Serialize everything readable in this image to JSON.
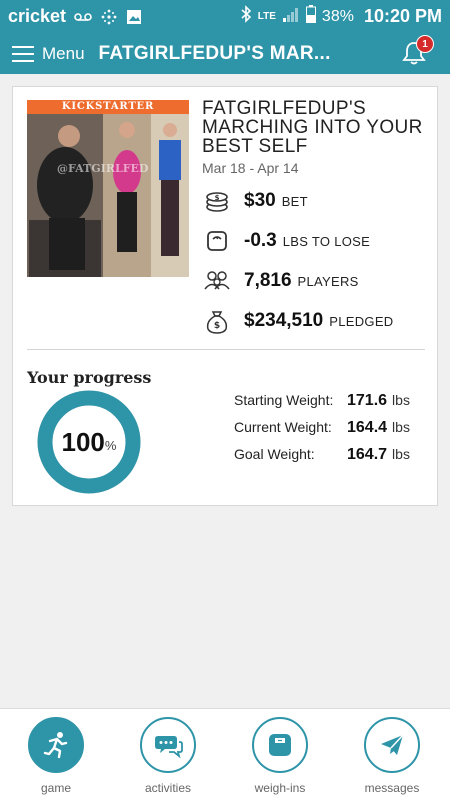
{
  "status_bar": {
    "carrier": "cricket",
    "network": "LTE",
    "battery": "38%",
    "time": "10:20 PM"
  },
  "app_bar": {
    "menu_label": "Menu",
    "title": "FATGIRLFEDUP'S MAR...",
    "notification_count": "1"
  },
  "challenge": {
    "image_banner": "KICKSTARTER",
    "image_watermark": "@FATGIRLFED",
    "title": "FATGIRLFEDUP'S MARCHING INTO YOUR BEST SELF",
    "dates": "Mar 18 - Apr 14",
    "stats": [
      {
        "icon": "coins-icon",
        "value": "$30",
        "unit": "BET"
      },
      {
        "icon": "scale-icon",
        "value": "-0.3",
        "unit": "LBS TO LOSE"
      },
      {
        "icon": "players-icon",
        "value": "7,816",
        "unit": "PLAYERS"
      },
      {
        "icon": "money-bag-icon",
        "value": "$234,510",
        "unit": "PLEDGED"
      }
    ]
  },
  "progress": {
    "heading": "Your progress",
    "percent_value": "100",
    "percent_sign": "%",
    "fraction": 1.0,
    "rows": [
      {
        "label": "Starting Weight:",
        "value": "171.6",
        "unit": "lbs"
      },
      {
        "label": "Current Weight:",
        "value": "164.4",
        "unit": "lbs"
      },
      {
        "label": "Goal Weight:",
        "value": "164.7",
        "unit": "lbs"
      }
    ]
  },
  "bottom_nav": [
    {
      "icon": "runner-icon",
      "label": "game",
      "active": true
    },
    {
      "icon": "chat-bubbles-icon",
      "label": "activities",
      "active": false
    },
    {
      "icon": "scale-icon",
      "label": "weigh-ins",
      "active": false
    },
    {
      "icon": "paper-plane-icon",
      "label": "messages",
      "active": false
    }
  ],
  "colors": {
    "primary": "#2e94a8",
    "badge": "#d62b2b",
    "banner": "#ee6c2e"
  }
}
